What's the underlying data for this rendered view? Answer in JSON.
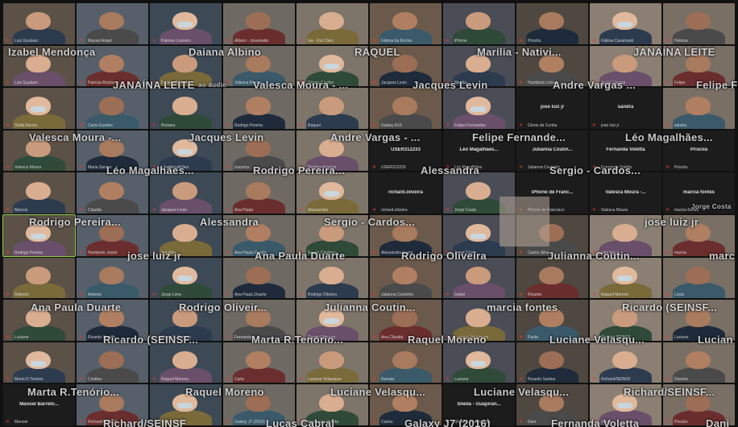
{
  "meeting": {
    "tile_names": [
      "Luiz Gustavo",
      "Mayxel Angel",
      "Paloma Loureiro",
      "Allison - Juventude",
      "Isa - Rio Claro",
      "Fátima da Rocha",
      "iPhone",
      "Priscila",
      "Fátima Cavalcanti",
      "Heloisa",
      "Luiz Gustavo",
      "Patrícia Rocha",
      "Daiana Albino",
      "Valesca Moura",
      "Sérgio Cardos",
      "Jacques Levin",
      "Marília",
      "Humberto Lima",
      "André Vargas",
      "Felipe",
      "Stella Nunes",
      "Carla Guedes",
      "Rosana",
      "Rodrigo Pereira",
      "Raquel",
      "Galaxy A10",
      "Felipe Fernandes",
      "Gloria da Cunha",
      "jose luiz jr",
      "sandra",
      "Valesca Moura",
      "Maria Santos",
      "Léo Magalhães",
      "Iracema",
      "Rodrigo Pereira",
      "USER312233",
      "Léo Magalhães",
      "Julianna Coutinho",
      "Fernanda Voletta",
      "Priscila",
      "Marcos",
      "Cláudia",
      "Jacques Levin",
      "Ana Paula",
      "Alessandra",
      "richard.oliveira",
      "Jorge Costa",
      "iPhone de Francisco",
      "Valesca Moura",
      "marcia fontes",
      "Rodrigo Pereira",
      "Humberto Junior",
      "Sandra",
      "Ana Paula Duarte",
      "Sergio Cardoso",
      "Alessandra Costa",
      "Jorge Costa",
      "Carlos Silva",
      "jose luiz jr",
      "marcia",
      "Roberto",
      "Antonio",
      "Jorge Lima",
      "Ana Paula Duarte",
      "Rodrigo Oliveira",
      "Julianna Coutinho",
      "Isabel",
      "Ricardo",
      "Raquel Moreno",
      "Lúcia",
      "Luciane",
      "Ricardo Santos",
      "Marta R. Tenório",
      "Fernanda",
      "Raquel Moreno",
      "Ana Cláudia",
      "Luciane Velasquez",
      "Paula",
      "Ricardo SEINSF",
      "Luciane",
      "Marta R.Tenório",
      "Cristina",
      "Raquel Moreno",
      "Carla",
      "Luciane Velasquez",
      "Renata",
      "Luciane",
      "Ricardo Santos",
      "Richard/SEINSF",
      "Daniela",
      "Manoel",
      "Richard/SEINSF",
      "Lucas Cabral",
      "Galaxy J7 (2016)",
      "Fernanda Voletta",
      "Carlos",
      "Sheila - Guapiranga",
      "Dani",
      "Jorge",
      "Priscila"
    ],
    "dark_labels": [
      {
        "index": 27,
        "text": "jose luiz jr"
      },
      {
        "index": 28,
        "text": "sandra"
      },
      {
        "index": 35,
        "text": "USER312233"
      },
      {
        "index": 36,
        "text": "Léo Magalhães..."
      },
      {
        "index": 37,
        "text": "Julianna Coutin..."
      },
      {
        "index": 38,
        "text": "Fernanda Voletta"
      },
      {
        "index": 39,
        "text": "Priscila"
      },
      {
        "index": 45,
        "text": "richard.oliveira"
      },
      {
        "index": 47,
        "text": "iPhone de Franc..."
      },
      {
        "index": 48,
        "text": "Valesca Moura -..."
      },
      {
        "index": 49,
        "text": "marcia fontes"
      },
      {
        "index": 90,
        "text": "Manoel Barreto..."
      },
      {
        "index": 96,
        "text": "Sheila - Guapiran..."
      }
    ],
    "overlay_names": [
      "Izabel Mendonça",
      "Daiana Albino",
      "RAQUEL",
      "Marília  -  Nativi...",
      "JANAÍNA LEITE",
      "JANAÍNA LEITE",
      "Valesca Moura - ...",
      "Jacques Levin",
      "Andre Vargas ...",
      "Felipe F",
      "Valesca Moura -...",
      "Jacques Levin",
      "Andre Vargas - ...",
      "Felipe Fernande...",
      "Léo  Magalhães...",
      "Léo  Magalhães...",
      "Rodrigo  Pereira...",
      "Alessandra",
      "Sergio - Cardos...",
      "Rodrigo  Pereira...",
      "Alessandra",
      "Sergio - Cardos...",
      "jose luiz jr",
      "jose luiz jr",
      "Ana Paula Duarte",
      "Rodrigo  Oliveira",
      "Julianna  Coutin...",
      "marc",
      "Ana Paula Duarte",
      "Rodrigo  Oliveir...",
      "Julianna  Coutin...",
      "marcia fontes",
      "Ricardo  (SEINSF...",
      "Ricardo  (SEINSF...",
      "Marta  R.Tenório...",
      "Raquel Moreno",
      "Luciane  Velasqu...",
      "Lucian",
      "Marta  R.Tenório...",
      "Raquel Moreno",
      "Luciane  Velasqu...",
      "Luciane  Velasqu...",
      "Richard/SEINSF...",
      "Richard/SEINSF",
      "Lucas Cabral",
      "Galaxy  J7 (2016)",
      "Fernanda Voletta",
      "Dani"
    ],
    "audio_overlay": "ao áudio",
    "jorge_costa": "Jorge Costa",
    "colors": {
      "background": "#111111",
      "tile_dark": "#1c1c1c",
      "muted_mic": "#e23b3b",
      "active_speaker": "#8fcf3f"
    }
  }
}
